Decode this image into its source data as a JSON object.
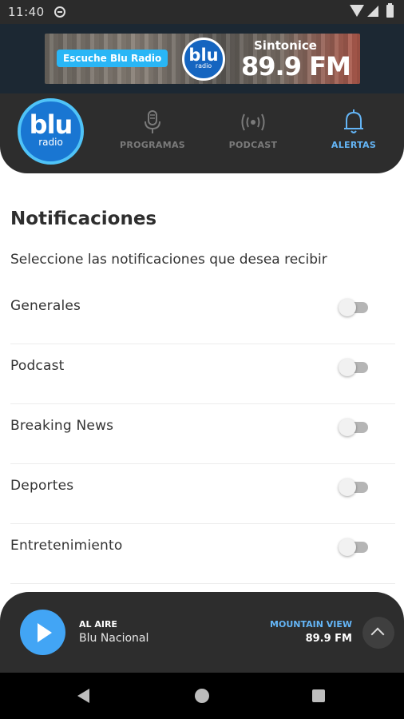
{
  "status_bar": {
    "time": "11:40"
  },
  "banner": {
    "pill": "Escuche Blu Radio",
    "logo_main": "blu",
    "logo_sub": "radio",
    "sintonice": "Sintonice",
    "frequency": "89.9 FM"
  },
  "header": {
    "logo_main": "blu",
    "logo_sub": "radio",
    "nav": [
      {
        "label": "PROGRAMAS",
        "icon": "microphone-icon"
      },
      {
        "label": "PODCAST",
        "icon": "podcast-icon"
      },
      {
        "label": "ALERTAS",
        "icon": "bell-icon",
        "active": true
      }
    ]
  },
  "main": {
    "title": "Notificaciones",
    "subtitle": "Seleccione las notificaciones que desea recibir",
    "items": [
      {
        "label": "Generales",
        "enabled": false
      },
      {
        "label": "Podcast",
        "enabled": false
      },
      {
        "label": "Breaking News",
        "enabled": false
      },
      {
        "label": "Deportes",
        "enabled": false
      },
      {
        "label": "Entretenimiento",
        "enabled": false
      }
    ]
  },
  "player": {
    "status": "AL AIRE",
    "station": "Blu Nacional",
    "city": "MOUNTAIN VIEW",
    "frequency": "89.9 FM"
  },
  "colors": {
    "accent": "#64b5f6",
    "header_bg": "#2d2d2d",
    "play_button": "#42a5f5"
  }
}
